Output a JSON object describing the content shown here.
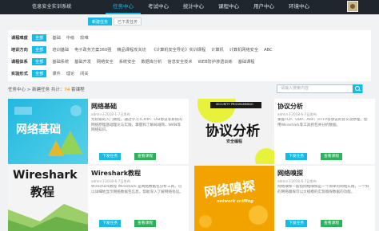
{
  "header": {
    "brand": "信息安全实训系统",
    "nav": [
      {
        "label": "任务中心"
      },
      {
        "label": "考试中心"
      },
      {
        "label": "统计中心"
      },
      {
        "label": "课程中心"
      },
      {
        "label": "用户中心"
      },
      {
        "label": "环境中心"
      }
    ],
    "active_index": 0
  },
  "subtabs": [
    {
      "label": "新建任务"
    },
    {
      "label": "已下发任务"
    }
  ],
  "filters": [
    {
      "label": "课程难度",
      "options": [
        "全部",
        "基础",
        "中级",
        "较难"
      ],
      "selected": 0
    },
    {
      "label": "培训方向",
      "options": [
        "全部",
        "培训基础",
        "电子政务方案360强",
        "精品课程攻关坊",
        "《计算机安全导论》实训课程",
        "计算机",
        "计算机网络安全",
        "ABC"
      ],
      "selected": 0
    },
    {
      "label": "课程体系",
      "options": [
        "全部",
        "基础系统",
        "基础开发",
        "网络安全",
        "系统安全",
        "数据库分析",
        "信息安全技术",
        "WEB防护渗透训练",
        "基础课程"
      ],
      "selected": 0
    },
    {
      "label": "实验形式",
      "options": [
        "全部",
        "课件",
        "理论",
        "闭关"
      ],
      "selected": 0
    }
  ],
  "crumb": {
    "text": "任务中心 > 新建任务",
    "count_prefix": " 共计：",
    "count": "74",
    "count_suffix": " 套课程"
  },
  "search": {
    "placeholder": "请输入搜索内容"
  },
  "cards": [
    {
      "title": "网络基础",
      "meta": "admin于2018-1-7日发布",
      "desc": "为初级的入门教程，通过学习TCP/IP、OSI协议等系统的网络原理基础理论与实践，掌握和了解局域网、WAN等网络知识。",
      "thumb_text": "网络基础",
      "issue": "下发任务",
      "view": "查看课程"
    },
    {
      "title": "协议分析",
      "meta": "admin于2018-6-7日发布",
      "desc": "掌握TCP、UDP、ARP、HTTP等协议的含义及原理，使用Wireshark等工具抓包并分析数据。",
      "thumb_text": "协议分析",
      "thumb_caption": "SECURITY PROGRAMMING",
      "thumb_sub": "安全编程",
      "issue": "下发任务",
      "view": "查看课程"
    },
    {
      "title": "Wireshark教程",
      "meta": "admin于2018-6-7日发布",
      "desc": "Wireshark教程 Wireshark 是网络数据包分析工具，可以详细地显示网络数据包信息，帮助深入了解网络协议。",
      "thumb_text": "Wireshark",
      "thumb_sub": "教程",
      "issue": "下发任务",
      "view": "查看课程"
    },
    {
      "title": "网络嗅探",
      "meta": "admin于2018-6-7日发布",
      "desc": "网络嗅探一般指网络嗅探是一个简单的网络实践，一个好的网络嗅探可以大规模的实现嗅探数据的功能。",
      "thumb_text": "网络嗅探",
      "thumb_caption": "network sniffing",
      "issue": "下发任务",
      "view": "查看课程"
    }
  ],
  "colors": {
    "accent": "#19b9e6",
    "green": "#2fb05c",
    "count": "#f08300",
    "topbar": "#1f262d"
  }
}
